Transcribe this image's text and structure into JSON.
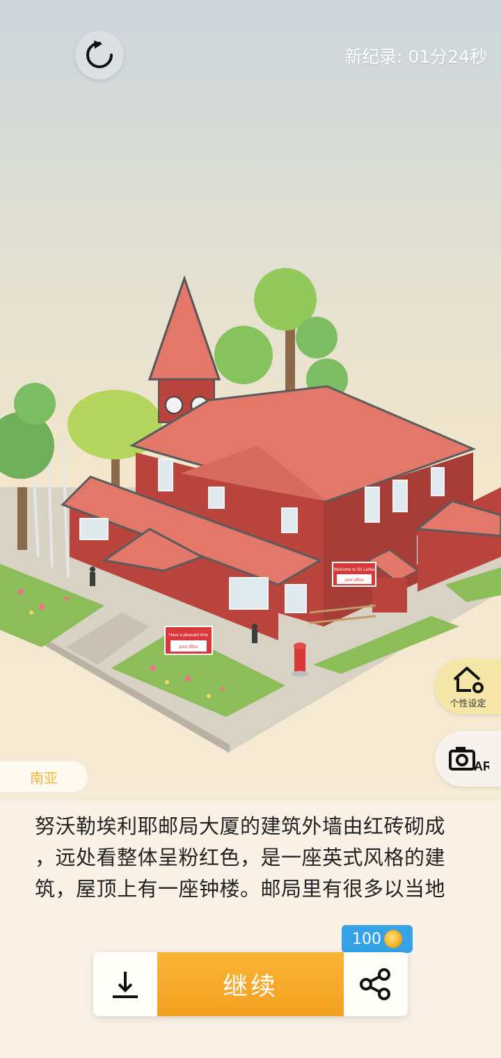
{
  "header": {
    "record_text": "新纪录: 01分24秒"
  },
  "side": {
    "custom_label": "个性设定",
    "ar_label": "AR"
  },
  "region_tag": "南亚",
  "description": {
    "lines": [
      "努沃勒埃利耶邮局大厦的建筑外墙由红砖砌成",
      "，远处看整体呈粉红色，是一座英式风格的建",
      "筑，屋顶上有一座钟楼。邮局里有很多以当地"
    ]
  },
  "actions": {
    "continue_label": "继续",
    "coin_amount": "100"
  },
  "scene": {
    "sign_line1": "Welcome to Sri Lanka",
    "sign_line2": "Have a pleasant time",
    "sign_line3": "post office"
  },
  "colors": {
    "accent_orange": "#f4a020",
    "badge_blue": "#36a3e6",
    "brick": "#b8443d",
    "roof": "#e2776a"
  }
}
